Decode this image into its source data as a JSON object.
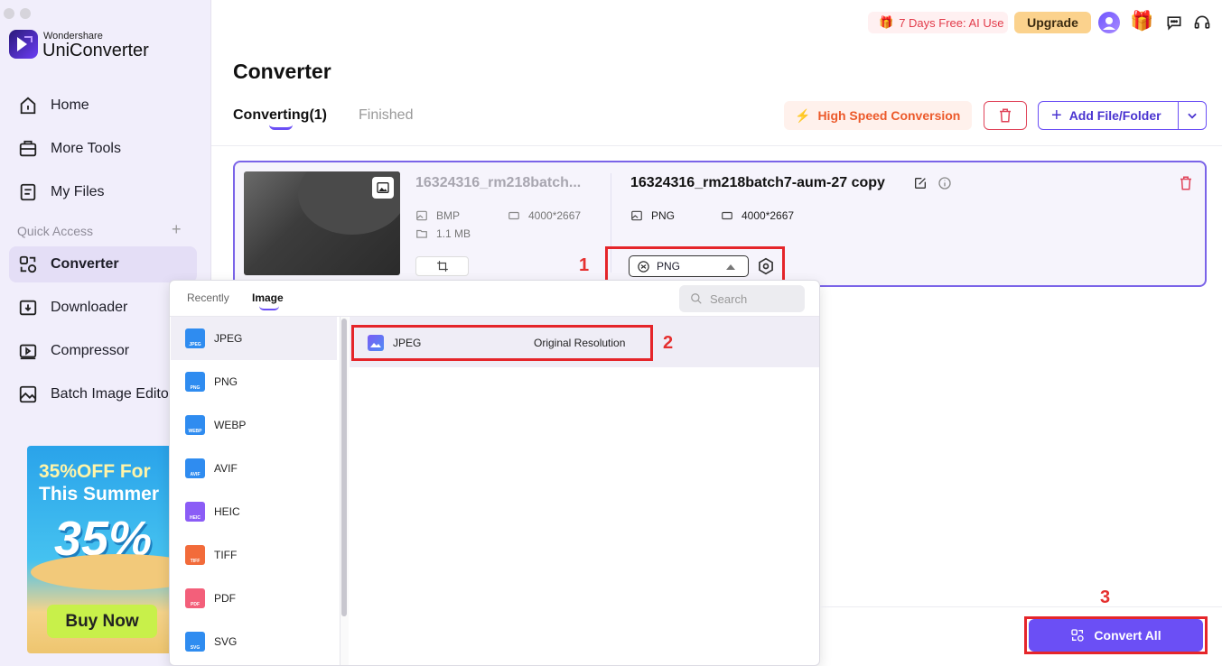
{
  "app": {
    "brand_top": "Wondershare",
    "brand_name": "UniConverter"
  },
  "sidebar": {
    "items": [
      {
        "label": "Home",
        "icon": "home-icon"
      },
      {
        "label": "More Tools",
        "icon": "toolbox-icon"
      },
      {
        "label": "My Files",
        "icon": "files-icon"
      }
    ],
    "quick_access_label": "Quick Access",
    "quick_items": [
      {
        "label": "Converter",
        "icon": "converter-icon",
        "active": true
      },
      {
        "label": "Downloader",
        "icon": "downloader-icon"
      },
      {
        "label": "Compressor",
        "icon": "compressor-icon"
      },
      {
        "label": "Batch Image Editor",
        "icon": "image-editor-icon"
      }
    ],
    "promo": {
      "line1": "35%OFF For",
      "line2": "This Summer",
      "big": "35%",
      "cta": "Buy Now"
    }
  },
  "topbar": {
    "trial": "7 Days Free: AI Use",
    "upgrade": "Upgrade"
  },
  "header": {
    "title": "Converter",
    "tabs": [
      "Converting(1)",
      "Finished"
    ],
    "high_speed": "High Speed Conversion",
    "add_file": "Add File/Folder"
  },
  "file": {
    "source_name": "16324316_rm218batch...",
    "source_format": "BMP",
    "source_resolution": "4000*2667",
    "source_size": "1.1 MB",
    "target_name": "16324316_rm218batch7-aum-27 copy",
    "target_format": "PNG",
    "target_resolution": "4000*2667",
    "format_select": "PNG"
  },
  "dropdown": {
    "tabs": [
      "Recently",
      "Image"
    ],
    "search_placeholder": "Search",
    "formats": [
      {
        "label": "JPEG",
        "badge": "JPEG",
        "color": "#2f8cf0"
      },
      {
        "label": "PNG",
        "badge": "PNG",
        "color": "#2f8cf0"
      },
      {
        "label": "WEBP",
        "badge": "WEBP",
        "color": "#2f8cf0"
      },
      {
        "label": "AVIF",
        "badge": "AVIF",
        "color": "#2f8cf0"
      },
      {
        "label": "HEIC",
        "badge": "HEIC",
        "color": "#8b5cf6"
      },
      {
        "label": "TIFF",
        "badge": "TIFF",
        "color": "#f26b3a"
      },
      {
        "label": "PDF",
        "badge": "PDF",
        "color": "#f35f7a"
      },
      {
        "label": "SVG",
        "badge": "SVG",
        "color": "#2f8cf0"
      }
    ],
    "preset": {
      "label": "JPEG",
      "resolution": "Original Resolution"
    }
  },
  "footer": {
    "convert_all": "Convert All"
  },
  "annotations": [
    "1",
    "2",
    "3"
  ],
  "colors": {
    "accent": "#6b4ff5",
    "annotation_red": "#e5252a",
    "sidebar_bg": "#f1eefb"
  }
}
